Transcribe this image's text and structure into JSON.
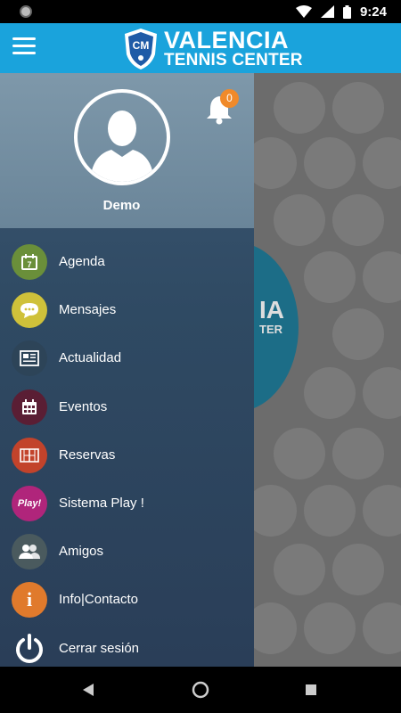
{
  "status_bar": {
    "time": "9:24"
  },
  "app": {
    "title_line1": "VALENCIA",
    "title_line2": "TENNIS CENTER",
    "logo_badge": "CM",
    "brand_color": "#1aa3dc"
  },
  "background": {
    "emblem_text1": "IA",
    "emblem_text2": "TER"
  },
  "drawer": {
    "user_name": "Demo",
    "notifications_count": "0",
    "menu": [
      {
        "label": "Agenda",
        "icon": "calendar-icon",
        "color": "#6a8f3a"
      },
      {
        "label": "Mensajes",
        "icon": "chat-icon",
        "color": "#cfc13a"
      },
      {
        "label": "Actualidad",
        "icon": "newspaper-icon",
        "color": "#2d4458"
      },
      {
        "label": "Eventos",
        "icon": "events-calendar-icon",
        "color": "#5a1e34"
      },
      {
        "label": "Reservas",
        "icon": "court-icon",
        "color": "#c2432b"
      },
      {
        "label": "Sistema Play !",
        "icon": "play-icon",
        "color": "#b0257b",
        "icon_text": "Play!"
      },
      {
        "label": "Amigos",
        "icon": "friends-icon",
        "color": "#4a5a5e"
      },
      {
        "label": "Info|Contacto",
        "icon": "info-icon",
        "color": "#e07a2c",
        "icon_text": "i"
      },
      {
        "label": "Cerrar sesión",
        "icon": "power-icon",
        "color": "#ffffff"
      }
    ]
  }
}
